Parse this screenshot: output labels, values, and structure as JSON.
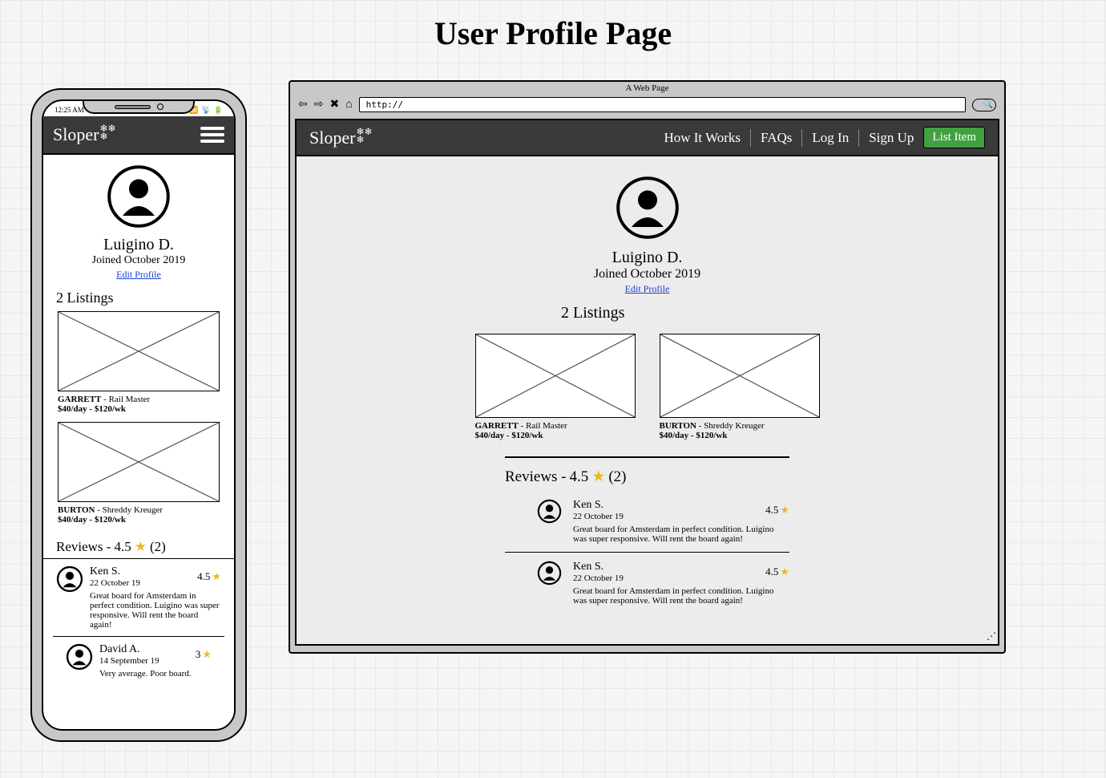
{
  "page_title": "User Profile Page",
  "brand": "Sloper",
  "snowflakes": "❄❄\n❄",
  "browser": {
    "chrome_label": "A Web Page",
    "url_value": "http://"
  },
  "status_bar_time": "12:25 AM",
  "nav": {
    "how": "How It Works",
    "faqs": "FAQs",
    "login": "Log In",
    "signup": "Sign Up",
    "list_item": "List Item"
  },
  "profile": {
    "name": "Luigino D.",
    "joined": "Joined October 2019",
    "edit": "Edit Profile"
  },
  "listings_header": "2 Listings",
  "listings": [
    {
      "brand": "GARRETT",
      "model": " - Rail Master",
      "price": "$40/day - $120/wk"
    },
    {
      "brand": "BURTON",
      "model": " - Shreddy Kreuger",
      "price": "$40/day - $120/wk"
    }
  ],
  "reviews_header": {
    "label": "Reviews - ",
    "avg": "4.5",
    "count": "(2)"
  },
  "reviews_desktop": [
    {
      "name": "Ken S.",
      "date": "22 October 19",
      "rating": "4.5",
      "body": "Great board for Amsterdam in perfect condition. Luigino was super responsive. Will rent the board again!"
    },
    {
      "name": "Ken S.",
      "date": "22 October 19",
      "rating": "4.5",
      "body": "Great board for Amsterdam in perfect condition. Luigino was super responsive. Will rent the board again!"
    }
  ],
  "reviews_mobile": [
    {
      "name": "Ken S.",
      "date": "22 October 19",
      "rating": "4.5",
      "body": "Great board for Amsterdam in perfect condition. Luigino was super responsive. Will rent the board again!"
    },
    {
      "name": "David A.",
      "date": "14 September 19",
      "rating": "3",
      "body": "Very average. Poor board."
    }
  ]
}
